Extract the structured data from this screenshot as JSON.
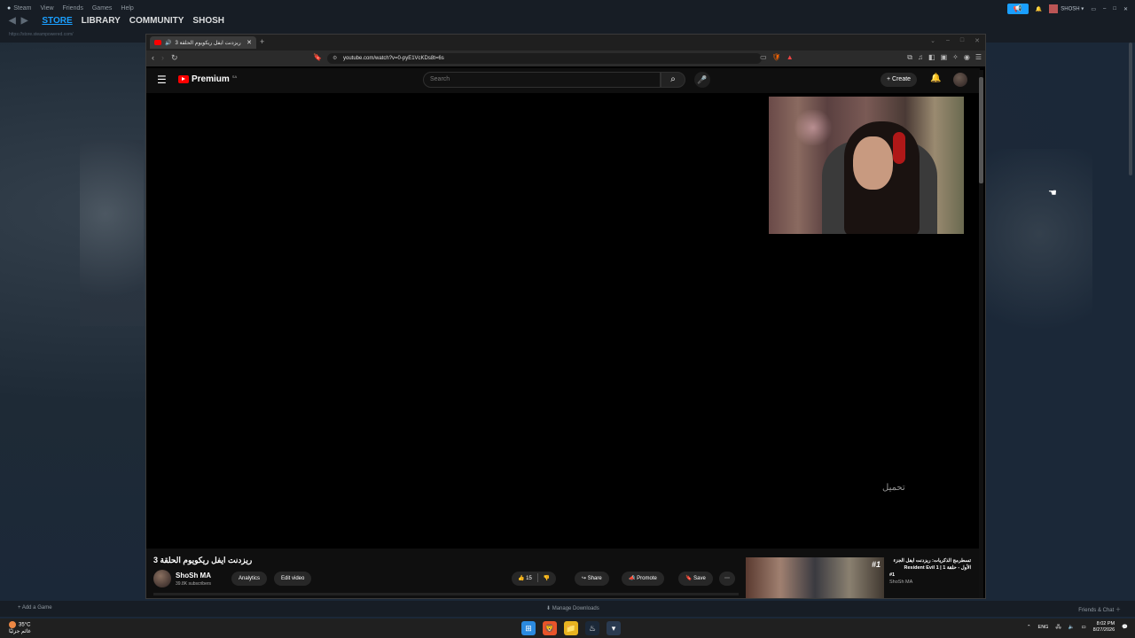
{
  "steam": {
    "menu": [
      "Steam",
      "View",
      "Friends",
      "Games",
      "Help"
    ],
    "nav": {
      "store": "STORE",
      "library": "LIBRARY",
      "community": "COMMUNITY",
      "user": "SHOSH"
    },
    "url": "https://store.steampowered.com/",
    "account_name": "SHOSH",
    "bottom": {
      "add_game": "Add a Game",
      "downloads": "Manage Downloads",
      "friends_chat": "Friends & Chat"
    }
  },
  "browser": {
    "tab_title": "ريزدنت ايفل ريكويوم الحلقة 3",
    "url": "youtube.com/watch?v=0-pyE1VcKDs8t=6s"
  },
  "youtube": {
    "logo_text": "Premium",
    "region_badge": "SA",
    "search_placeholder": "Search",
    "create_label": "Create",
    "video_caption": "تحميل",
    "video_title": "ريزدنت ايفل ريكويوم الحلقة 3",
    "channel": {
      "name": "ShoSh MA",
      "subscribers": "39.8K subscribers"
    },
    "buttons": {
      "analytics": "Analytics",
      "edit_video": "Edit video",
      "likes": "15",
      "share": "Share",
      "promote": "Promote",
      "save": "Save"
    },
    "recommendation": {
      "title_line1": "تسطرمج الذكريات: ريزدنت ايفل الجزء",
      "title_line2": "الأول - حلقة 1 | Resident Evil 1",
      "title_line3": "#1",
      "channel": "ShoSh MA",
      "badge": "#1"
    }
  },
  "taskbar": {
    "temp": "35°C",
    "weather_desc": "غائم جزئيًا",
    "lang": "ENG",
    "time": "8:02 PM",
    "date": "8/27/2026"
  }
}
